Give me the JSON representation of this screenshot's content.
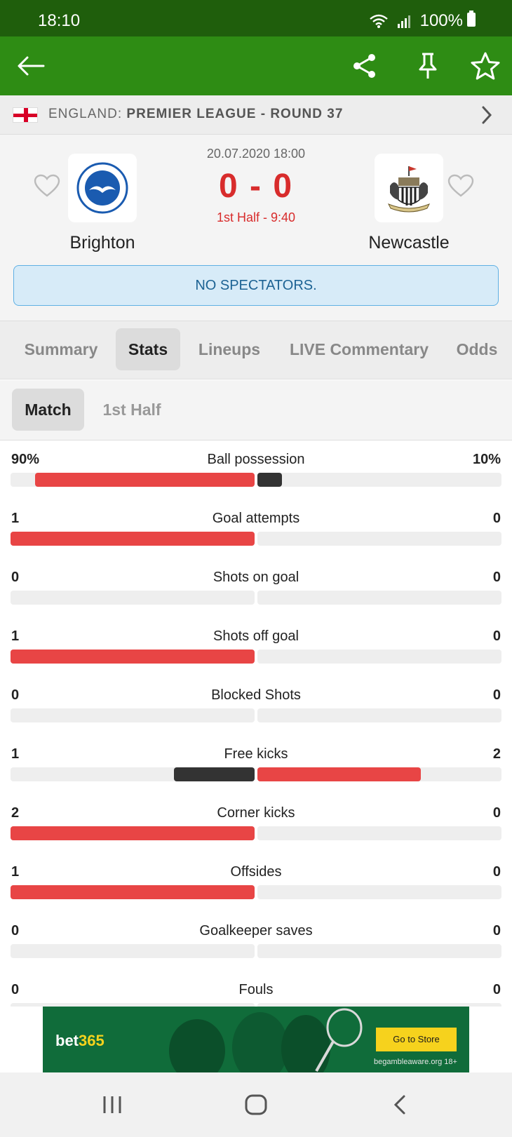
{
  "status_bar": {
    "time": "18:10",
    "battery": "100%"
  },
  "league": {
    "country": "ENGLAND:",
    "name": "PREMIER LEAGUE - ROUND 37"
  },
  "match": {
    "datetime": "20.07.2020 18:00",
    "score": "0 - 0",
    "minute": "1st Half - 9:40",
    "home_team": "Brighton",
    "away_team": "Newcastle",
    "notice": "NO SPECTATORS."
  },
  "tabs": [
    {
      "label": "Summary",
      "active": false
    },
    {
      "label": "Stats",
      "active": true
    },
    {
      "label": "Lineups",
      "active": false
    },
    {
      "label": "LIVE Commentary",
      "active": false
    },
    {
      "label": "Odds",
      "active": false
    }
  ],
  "subtabs": [
    {
      "label": "Match",
      "active": true
    },
    {
      "label": "1st Half",
      "active": false
    }
  ],
  "colors": {
    "leader": "#e84545",
    "trailer": "#333333",
    "track": "#eeeeee",
    "brand_green": "#2e8c14",
    "score_red": "#d82c2c"
  },
  "stats": [
    {
      "label": "Ball possession",
      "home": "90%",
      "away": "10%",
      "home_share": 0.9,
      "away_share": 0.1
    },
    {
      "label": "Goal attempts",
      "home": "1",
      "away": "0",
      "home_share": 1.0,
      "away_share": 0.0
    },
    {
      "label": "Shots on goal",
      "home": "0",
      "away": "0",
      "home_share": 0.0,
      "away_share": 0.0
    },
    {
      "label": "Shots off goal",
      "home": "1",
      "away": "0",
      "home_share": 1.0,
      "away_share": 0.0
    },
    {
      "label": "Blocked Shots",
      "home": "0",
      "away": "0",
      "home_share": 0.0,
      "away_share": 0.0
    },
    {
      "label": "Free kicks",
      "home": "1",
      "away": "2",
      "home_share": 0.33,
      "away_share": 0.67
    },
    {
      "label": "Corner kicks",
      "home": "2",
      "away": "0",
      "home_share": 1.0,
      "away_share": 0.0
    },
    {
      "label": "Offsides",
      "home": "1",
      "away": "0",
      "home_share": 1.0,
      "away_share": 0.0
    },
    {
      "label": "Goalkeeper saves",
      "home": "0",
      "away": "0",
      "home_share": 0.0,
      "away_share": 0.0
    },
    {
      "label": "Fouls",
      "home": "0",
      "away": "0",
      "home_share": 0.0,
      "away_share": 0.0
    }
  ],
  "ad": {
    "brand_prefix": "bet",
    "brand_suffix": "365",
    "cta": "Go to Store",
    "disclaimer": "begambleaware.org 18+"
  }
}
